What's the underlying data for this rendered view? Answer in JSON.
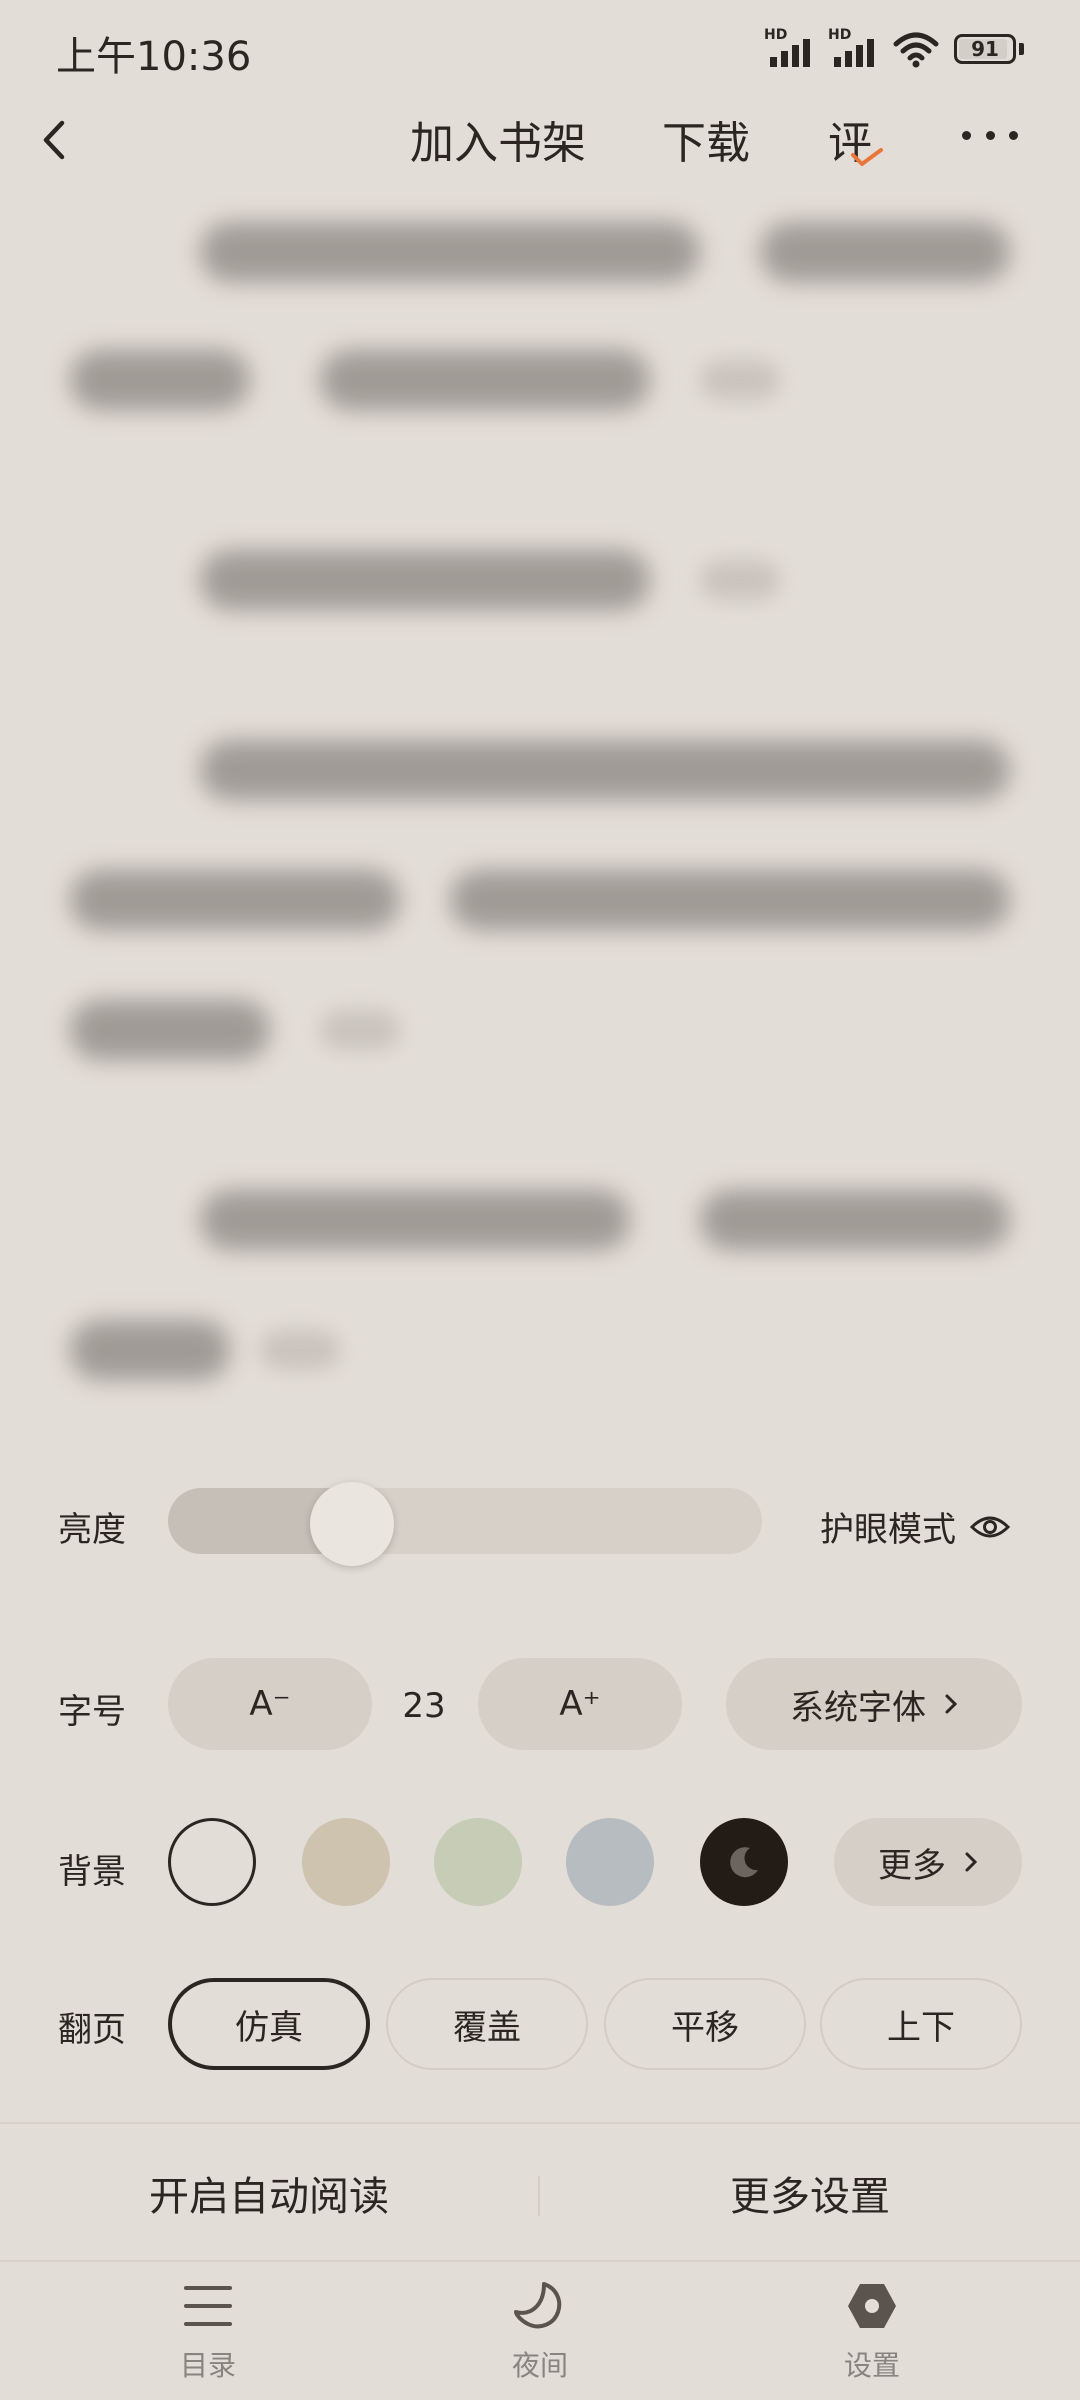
{
  "status_bar": {
    "time": "上午10:36",
    "signal_1_badge": "HD",
    "signal_2_badge": "HD",
    "battery_level": "91",
    "icons": [
      "signal-icon",
      "signal-icon",
      "wifi-icon",
      "battery-icon"
    ]
  },
  "top_bar": {
    "add_to_shelf": "加入书架",
    "download": "下载",
    "review": "评"
  },
  "settings": {
    "brightness_label": "亮度",
    "brightness_value": 0.31,
    "eye_mode_label": "护眼模式",
    "font_label": "字号",
    "font_decrease": "A⁻",
    "font_size": "23",
    "font_increase": "A⁺",
    "font_family_button": "系统字体",
    "background_label": "背景",
    "background_swatches": [
      "#ffffff",
      "#cdc3ae",
      "#c6ccb6",
      "#b7bcc1",
      "#221b16"
    ],
    "background_selected": 0,
    "background_more": "更多",
    "page_flip_label": "翻页",
    "page_flip_options": [
      "仿真",
      "覆盖",
      "平移",
      "上下"
    ],
    "page_flip_selected": 0
  },
  "actions": {
    "auto_read": "开启自动阅读",
    "more_settings": "更多设置"
  },
  "bottom_nav": {
    "toc": "目录",
    "night": "夜间",
    "settings": "设置"
  },
  "colors": {
    "background": "#e3ddd7",
    "text": "#2b2622",
    "accent": "#e8763a"
  }
}
